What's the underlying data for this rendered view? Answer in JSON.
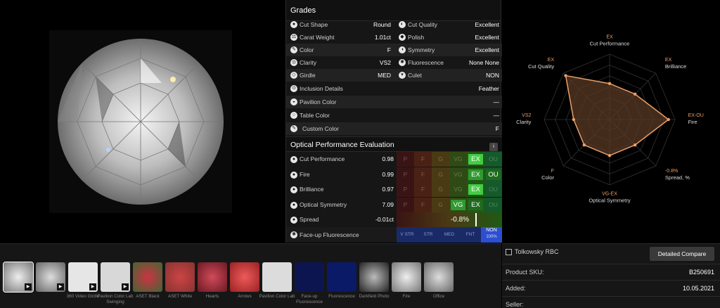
{
  "grades": {
    "title": "Grades",
    "rows": [
      {
        "label": "Cut Shape",
        "value": "Round"
      },
      {
        "label": "Cut Quality",
        "value": "Excellent"
      },
      {
        "label": "Carat Weight",
        "value": "1.01ct"
      },
      {
        "label": "Polish",
        "value": "Excellent"
      },
      {
        "label": "Color",
        "value": "F"
      },
      {
        "label": "Symmetry",
        "value": "Excellent"
      },
      {
        "label": "Clarity",
        "value": "VS2"
      },
      {
        "label": "Fluorescence",
        "value": "None None"
      },
      {
        "label": "Girdle",
        "value": "MED"
      },
      {
        "label": "Culet",
        "value": "NON"
      },
      {
        "label": "Inclusion Details",
        "value": "Feather"
      },
      {
        "label": "Pavilion Color",
        "value": "—"
      },
      {
        "label": "Table Color",
        "value": "—"
      },
      {
        "label": "Custom Color",
        "value": "F"
      }
    ]
  },
  "ope": {
    "title": "Optical Performance Evaluation",
    "info_label": "i",
    "scale_grades": [
      "P",
      "F",
      "G",
      "VG",
      "EX",
      "OU"
    ],
    "rows": [
      {
        "label": "Cut Performance",
        "value": "0.98",
        "mark": "EX"
      },
      {
        "label": "Fire",
        "value": "0.99",
        "mark": "EX",
        "mark2": "OU"
      },
      {
        "label": "Brilliance",
        "value": "0.97",
        "mark": "EX"
      },
      {
        "label": "Optical Symmetry",
        "value": "7.09",
        "mark": "VG",
        "mark2": "EX"
      },
      {
        "label": "Spread",
        "value": "-0.01ct",
        "mark": "-0.8%"
      }
    ],
    "fluor_label": "Face-up Fluorescence",
    "fluor_scale": [
      "V STR",
      "STR",
      "MED",
      "FNT"
    ],
    "fluor_value": "NON",
    "fluor_pct": "100%"
  },
  "radar": {
    "axes": [
      {
        "grade": "EX",
        "name": "Cut Performance",
        "level": 0.55
      },
      {
        "grade": "EX",
        "name": "Brilliance",
        "level": 0.55
      },
      {
        "grade": "EX-OU",
        "name": "Fire",
        "level": 0.9
      },
      {
        "grade": "-0.8%",
        "name": "Spread, %",
        "level": 0.55
      },
      {
        "grade": "VG-EX",
        "name": "Optical Symmetry",
        "level": 0.55
      },
      {
        "grade": "F",
        "name": "Color",
        "level": 0.55
      },
      {
        "grade": "VS2",
        "name": "Clarity",
        "level": 0.55
      },
      {
        "grade": "EX",
        "name": "Cut Quality",
        "level": 0.95
      }
    ],
    "accent": "#e9a06a",
    "fill": "#5a3a26"
  },
  "thumbs": [
    {
      "label": "",
      "video": true
    },
    {
      "label": "",
      "video": true
    },
    {
      "label": "360 Video Girdle",
      "video": true
    },
    {
      "label": "Pavilion Color Lab Swinging",
      "video": true
    },
    {
      "label": "ASET Black",
      "video": false
    },
    {
      "label": "ASET White",
      "video": false
    },
    {
      "label": "Hearts",
      "video": false
    },
    {
      "label": "Arrows",
      "video": false
    },
    {
      "label": "Pavilion Color Lab",
      "video": false
    },
    {
      "label": "Face-up Fluorescence",
      "video": false
    },
    {
      "label": "Fluorescence",
      "video": false
    },
    {
      "label": "Darkfield Photo",
      "video": false
    },
    {
      "label": "Fire",
      "video": false
    },
    {
      "label": "Office",
      "video": false
    }
  ],
  "play_icon": "▶",
  "details": {
    "tolkowsky_label": "Tolkowsky RBC",
    "compare_label": "Detailed Compare",
    "sku_label": "Product SKU:",
    "sku_value": "B250691",
    "added_label": "Added:",
    "added_value": "10.05.2021",
    "seller_label": "Seller:"
  }
}
